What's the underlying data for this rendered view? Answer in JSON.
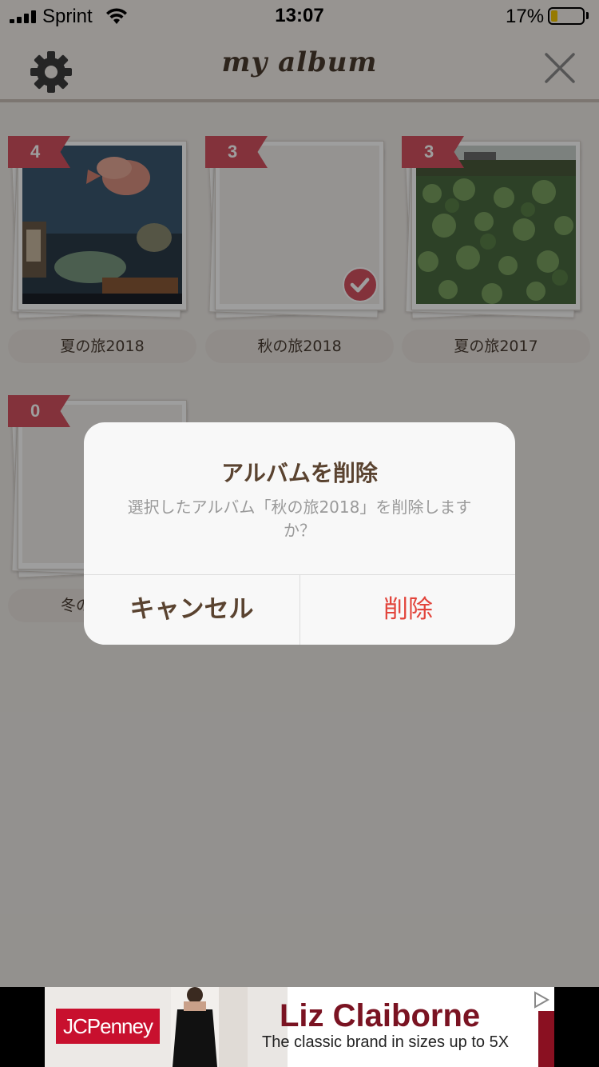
{
  "status_bar": {
    "carrier": "Sprint",
    "time": "13:07",
    "battery_percent": "17%",
    "battery_level": 0.17
  },
  "nav": {
    "title": "my album",
    "left_icon": "gear-icon",
    "right_icon": "close-icon"
  },
  "albums": [
    {
      "count": "4",
      "name": "夏の旅2018",
      "photo": "aquarium-fish"
    },
    {
      "count": "3",
      "name": "秋の旅2018",
      "photo": "empty",
      "selected": true
    },
    {
      "count": "3",
      "name": "夏の旅2017",
      "photo": "lotus-pond"
    },
    {
      "count": "0",
      "name": "冬の",
      "photo": "empty"
    }
  ],
  "dialog": {
    "title": "アルバムを削除",
    "message": "選択したアルバム「秋の旅2018」を削除しますか？",
    "cancel_label": "キャンセル",
    "delete_label": "削除"
  },
  "ad": {
    "logo": "JCPenney",
    "headline": "Liz Claiborne",
    "tagline": "The classic brand in sizes up to 5X"
  },
  "colors": {
    "accent_red": "#d4525f",
    "delete_red": "#e2453c",
    "dialog_text_brown": "#5a4330"
  }
}
